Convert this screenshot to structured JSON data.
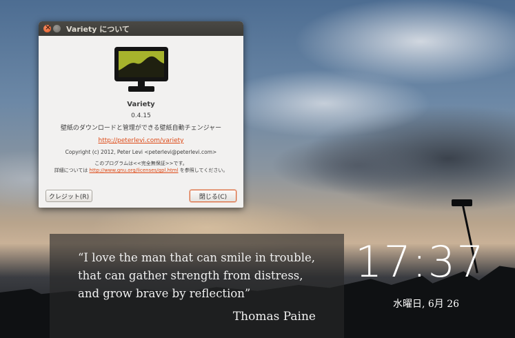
{
  "window": {
    "title": "Variety について"
  },
  "about": {
    "app_name": "Variety",
    "version": "0.4.15",
    "description": "壁紙のダウンロードと管理ができる壁紙自動チェンジャー",
    "website": "http://peterlevi.com/variety",
    "copyright": "Copyright (c) 2012, Peter Levi <peterlevi@peterlevi.com>",
    "license_line1": "このプログラムは<<完全無保証>>です。",
    "license_prefix": "詳細については ",
    "license_link": "http://www.gnu.org/licenses/gpl.html",
    "license_suffix": " を参照してください。",
    "credits_label": "クレジット(R)",
    "close_label": "閉じる(C)",
    "icon": "monitor-icon",
    "accent_color": "#dd4814"
  },
  "quote": {
    "text": "“I love the man that can smile in trouble, that can gather strength from distress, and grow brave by reflection”",
    "author": "Thomas Paine"
  },
  "clock": {
    "time": "17:37",
    "date": "水曜日, 6月 26"
  }
}
